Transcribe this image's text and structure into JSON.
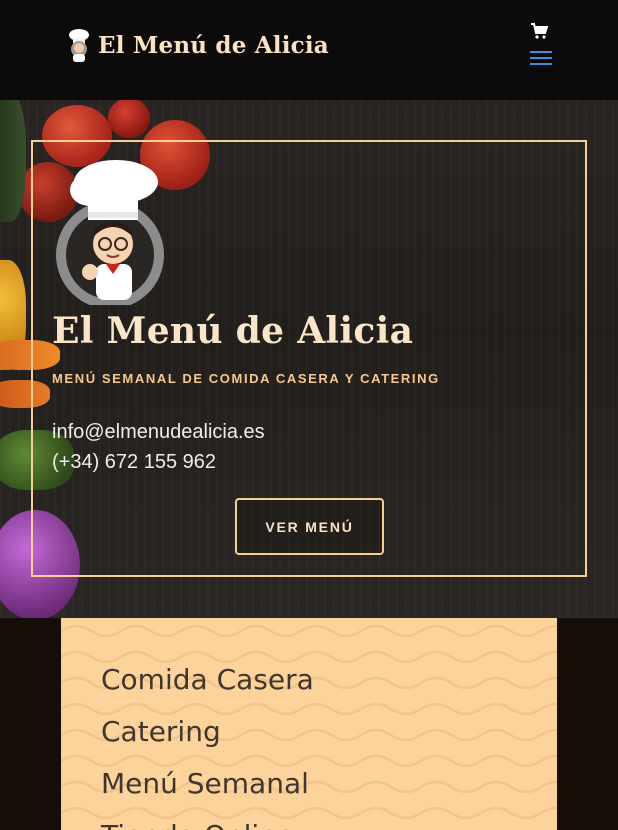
{
  "header": {
    "logo_text": "El Menú de Alicia",
    "icons": {
      "cart": "cart-icon",
      "menu": "hamburger-menu-icon"
    },
    "menu_icon_color": "#3f8de0"
  },
  "hero": {
    "title": "El Menú de Alicia",
    "subtitle": "MENÚ SEMANAL DE COMIDA CASERA Y CATERING",
    "email": "info@elmenudealicia.es",
    "phone": "(+34) 672 155 962",
    "cta_label": "VER MENÚ",
    "accent_color": "#f6cf95"
  },
  "services": {
    "items": [
      {
        "label": "Comida Casera"
      },
      {
        "label": "Catering"
      },
      {
        "label": "Menú Semanal"
      },
      {
        "label": "Tienda Online"
      }
    ],
    "panel_color": "#fcd39b"
  }
}
